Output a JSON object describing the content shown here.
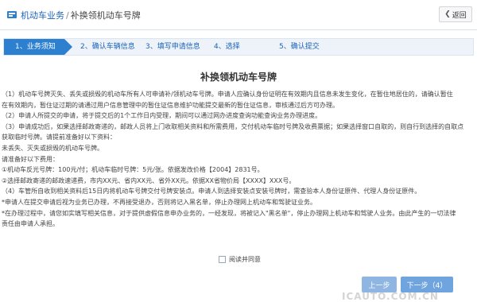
{
  "header": {
    "breadcrumb_root": "机动车业务",
    "breadcrumb_sep": "/",
    "breadcrumb_current": "补换领机动车号牌",
    "back_label": "返回"
  },
  "steps": [
    {
      "label": "1、业务须知"
    },
    {
      "label": "2、确认车辆信息"
    },
    {
      "label": "3、填写申请信息"
    },
    {
      "label": "4、选择"
    },
    {
      "label": "5、确认提交"
    }
  ],
  "main": {
    "title": "补换领机动车号牌",
    "lines": [
      "（1）机动车号牌灭失、丢失或损毁的机动车所有人可申请补/领机动车号牌。申请人应确认身份证明在有效期内且信息未发生变化，在暂住地居住的，请确认暂住",
      "在有效期内，暂住证过期的请通过用户信息管理中的暂住证信息维护功能提交最新的暂住证信息，审核通过后方可办理。",
      "（2）申请人所提交的申请，将于提交后的1个工作日内受理，期间可以通过网办进度查询功能查询业务办理进度。",
      "（3）申请成功后，如果选择邮政寄递的，邮政人员将上门收取相关资料和所需费用，交付机动车临时号牌及收费票据；如果选择窗口自取的，则自行到选择的自取点",
      "获取临时号牌。请提前准备好以下资料：",
      "     未丢失、灭失或损毁的机动车号牌。",
      "请准备好以下费用：",
      "  ①机动车反光号牌：100元/付；机动车临时号牌：5元/张。依据发改价格【2004】2831号。",
      "  ②选择邮政寄递的邮政速递费，市内XX元、省内XX元、省外XX元。依据XX省物价局【XXXX】XXX号。",
      "（4）车管所自收到相关资料后15日内将机动车号牌交付号牌安装点。申请人到选择安装点安装号牌时，需查验本人身份证原件、代理人身份证原件。",
      "*申请人在提交申请后视为业务已办理，不再接受退办，否则将记入黑名单，停止办理网上机动车和驾驶证业务。",
      "*在办理过程中，请您如实填写相关信息，对于提供虚假信息申办业务的，一经发现，将被记入\"黑名单\"，停止办理网上机动车和驾驶人业务。由此产生的一切法律",
      "责任由申请人承担。"
    ],
    "agree_label": "阅读并同意"
  },
  "buttons": {
    "prev": "上一步",
    "next": "下一步（4）"
  },
  "watermark": "ICAUTO.COM.CN"
}
